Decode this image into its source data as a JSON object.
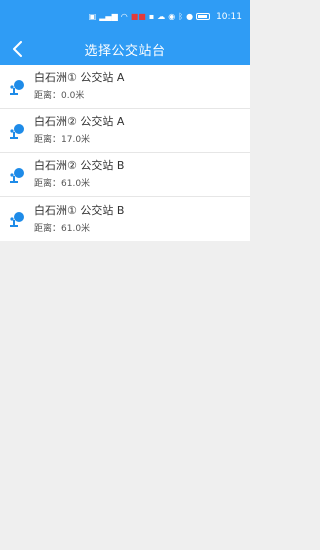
{
  "status_bar": {
    "time": "10:11",
    "battery_level": 0.9,
    "icons": [
      "nfc-icon",
      "signal-icon",
      "wifi-icon",
      "app-notification-icon",
      "chat-icon",
      "cloud-icon",
      "eye-icon",
      "bluetooth-icon",
      "location-icon",
      "battery-icon"
    ]
  },
  "header": {
    "title": "选择公交站台",
    "back_icon": "chevron-left-icon"
  },
  "colors": {
    "primary": "#2f9cf5",
    "background": "#efefef",
    "icon": "#1e8be8"
  },
  "stops": [
    {
      "name": "白石洲① 公交站 A",
      "distance": "距离：0.0米"
    },
    {
      "name": "白石洲② 公交站 A",
      "distance": "距离：17.0米"
    },
    {
      "name": "白石洲② 公交站 B",
      "distance": "距离：61.0米"
    },
    {
      "name": "白石洲① 公交站 B",
      "distance": "距离：61.0米"
    }
  ]
}
